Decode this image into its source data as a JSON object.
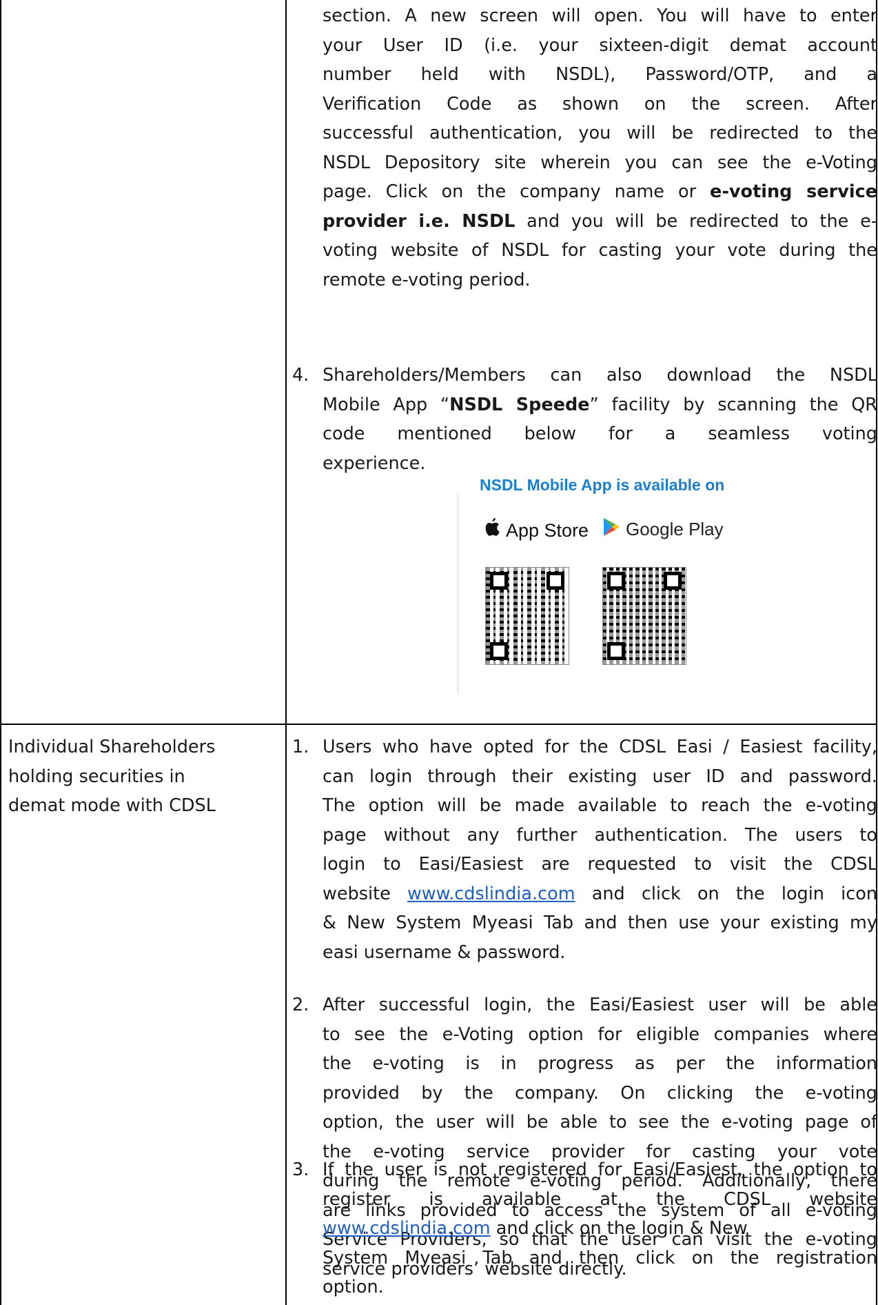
{
  "row1": {
    "item3": {
      "line1": "section. A new screen will open. You will have to enter",
      "line2": "your User ID (i.e. your sixteen-digit demat account",
      "line3": "number held with NSDL), Password/OTP, and a",
      "line4": "Verification Code as shown on the screen. After",
      "line5": "successful authentication, you will be redirected to the",
      "line6": "NSDL Depository site wherein you can see the e-Voting",
      "line7a": "page. Click on the company name or ",
      "line7b": "e-voting service",
      "line8a": "provider i.e. NSDL",
      "line8b": " and you will be redirected to the e-",
      "line9": "voting website of NSDL for casting your vote during the",
      "line10": "remote e-voting period."
    },
    "item4": {
      "number": "4.",
      "line1": "Shareholders/Members can also download the NSDL",
      "line2a": "Mobile App “",
      "line2b": "NSDL Speede",
      "line2c": "” facility by scanning the QR",
      "line3": "code mentioned below for a seamless voting",
      "line4": "experience."
    },
    "app_promo": {
      "title": "NSDL Mobile App is available on",
      "app_store": "App Store",
      "google_play": "Google Play"
    }
  },
  "row2": {
    "left_cell": {
      "line1": "Individual Shareholders",
      "line2": "holding securities in",
      "line3": "demat mode with CDSL"
    },
    "item1": {
      "number": "1.",
      "line1": "Users who have opted for the CDSL Easi / Easiest facility,",
      "line2": "can login through their existing user ID and password.",
      "line3": "The option will be made available to reach the e-voting",
      "line4": "page without any further authentication. The users to",
      "line5": "login to Easi/Easiest are requested to visit the CDSL",
      "line6a": "website ",
      "line6b": "www.cdslindia.com",
      "line6c": " and click on the login icon",
      "line7": "& New System Myeasi Tab and then use your existing my",
      "line8": "easi username & password."
    },
    "item2": {
      "number": "2.",
      "lines": [
        "After successful login, the Easi/Easiest user will be able",
        "to see the e-Voting option for eligible companies where",
        "the e-voting is in progress as per the information",
        "provided by the company. On clicking the e-voting",
        "option, the user will be able to see the e-voting page of",
        "the e-voting service provider for casting your vote",
        "during the remote e-voting period. Additionally, there",
        "are links provided to access the system of all e-voting",
        "Service Providers, so that the user can visit the e-voting",
        "service providers’ website directly."
      ]
    },
    "item3": {
      "number": "3.",
      "line1": "If the user is not registered for Easi/Easiest, the option to",
      "line2": "register is available at the CDSL website",
      "line3": "www.cdslindia.com",
      "line4a": " and click on the login & New",
      "line5": "System Myeasi Tab and then click on the registration",
      "line6": "option."
    }
  }
}
